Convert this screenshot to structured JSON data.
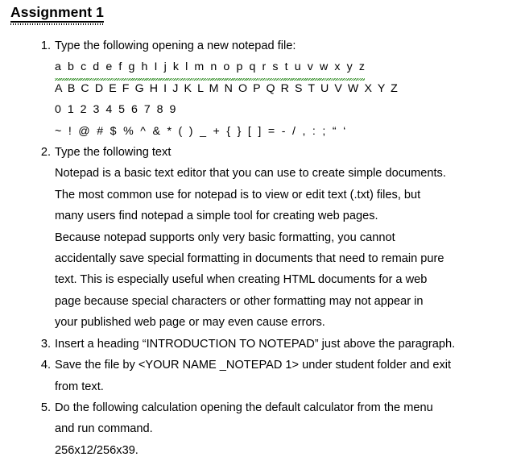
{
  "document": {
    "title": "Assignment 1",
    "title_has_underline": true,
    "title_has_grammar_dots": true,
    "text_color": "#000000",
    "background_color": "#ffffff",
    "spellcheck_squiggle_color": "#2e8b22"
  },
  "items": [
    {
      "number": "1.",
      "lines": [
        "Type the following opening a new notepad file:",
        "a b c d e f g h I j k l m n o p q r s t u v w x y z",
        "A B C D E F G H I J K L M N O P Q R S T U V W X Y Z",
        "0 1 2 3 4 5 6 7 8 9",
        "~ ! @ # $ % ^ & * ( ) _ + { } [ ] = - / , : ; “ ‘"
      ],
      "spellcheck_first_char_line_index": 1
    },
    {
      "number": "2.",
      "lines": [
        "Type the following text",
        "Notepad is a basic text editor that you can use to create simple documents.",
        "The most common use for notepad is to view or edit text (.txt) files, but",
        "many users find notepad a simple tool for creating web pages.",
        "Because notepad supports only very basic formatting, you cannot",
        "accidentally save special formatting in documents that need to remain pure",
        "text. This is especially useful when creating HTML documents for a web",
        "page because special characters or other formatting may not appear in",
        "your published web page or may even cause errors."
      ]
    },
    {
      "number": "3.",
      "lines": [
        "Insert a heading “INTRODUCTION TO NOTEPAD” just above the paragraph."
      ]
    },
    {
      "number": "4.",
      "lines": [
        "Save the file by <YOUR NAME _NOTEPAD 1> under student folder and exit",
        "from text."
      ]
    },
    {
      "number": "5.",
      "lines": [
        "Do the following calculation opening the default calculator from the menu",
        "and run command.",
        "256x12/256x39."
      ]
    }
  ]
}
